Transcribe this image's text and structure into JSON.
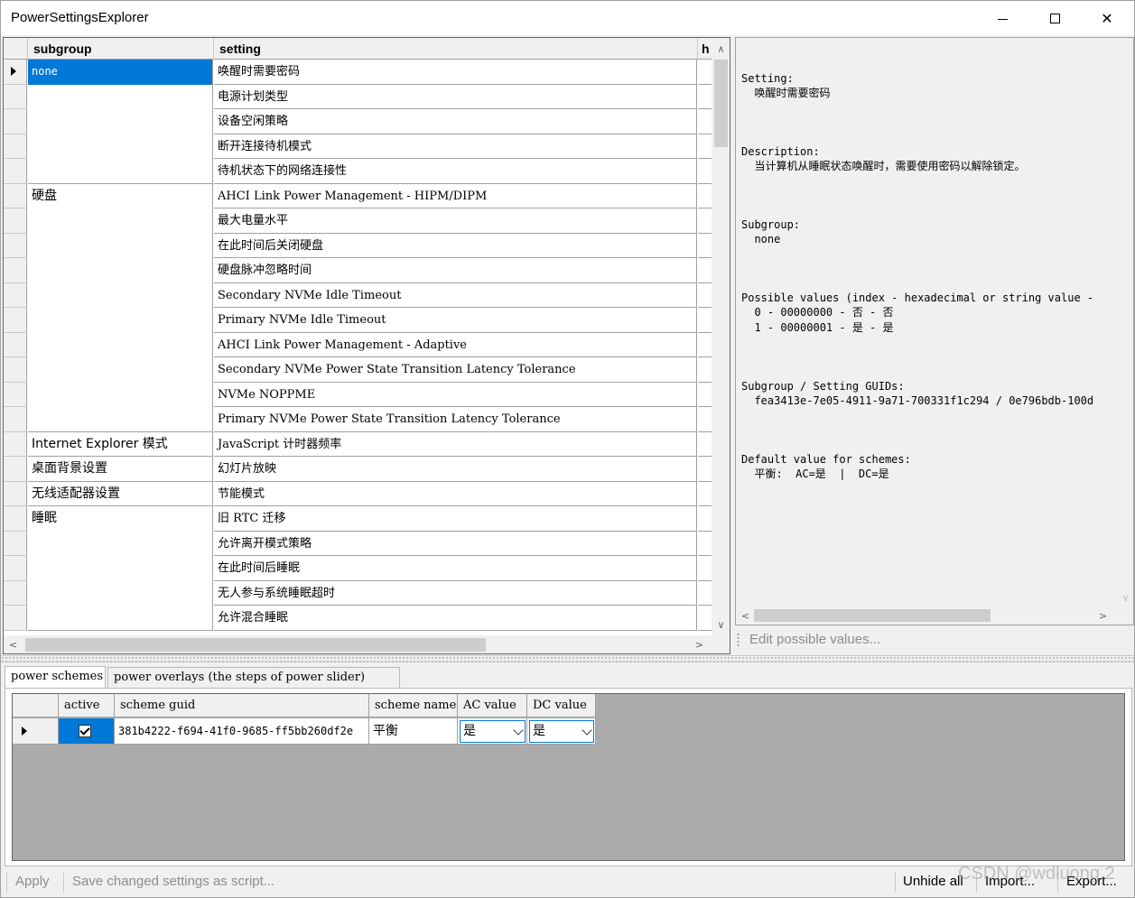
{
  "window": {
    "title": "PowerSettingsExplorer",
    "minimize_icon": "minimize-icon",
    "maximize_icon": "maximize-icon",
    "close_label": "✕"
  },
  "grid": {
    "columns": {
      "subgroup": "subgroup",
      "setting": "setting",
      "h": "h"
    },
    "rows": [
      {
        "subgroup": "none",
        "setting": "唤醒时需要密码",
        "selected": true
      },
      {
        "subgroup": "",
        "setting": "电源计划类型"
      },
      {
        "subgroup": "",
        "setting": "设备空闲策略"
      },
      {
        "subgroup": "",
        "setting": "断开连接待机模式"
      },
      {
        "subgroup": "",
        "setting": "待机状态下的网络连接性"
      },
      {
        "subgroup": "硬盘",
        "setting": "AHCI Link Power Management - HIPM/DIPM"
      },
      {
        "subgroup": "",
        "setting": "最大电量水平"
      },
      {
        "subgroup": "",
        "setting": "在此时间后关闭硬盘"
      },
      {
        "subgroup": "",
        "setting": "硬盘脉冲忽略时间"
      },
      {
        "subgroup": "",
        "setting": "Secondary NVMe Idle Timeout"
      },
      {
        "subgroup": "",
        "setting": "Primary NVMe Idle Timeout"
      },
      {
        "subgroup": "",
        "setting": "AHCI Link Power Management - Adaptive"
      },
      {
        "subgroup": "",
        "setting": "Secondary NVMe Power State Transition Latency Tolerance"
      },
      {
        "subgroup": "",
        "setting": "NVMe NOPPME"
      },
      {
        "subgroup": "",
        "setting": "Primary NVMe Power State Transition Latency Tolerance"
      },
      {
        "subgroup": "Internet Explorer 模式",
        "setting": "JavaScript 计时器频率"
      },
      {
        "subgroup": "桌面背景设置",
        "setting": "幻灯片放映"
      },
      {
        "subgroup": "无线适配器设置",
        "setting": "节能模式"
      },
      {
        "subgroup": "睡眠",
        "setting": "旧 RTC 迁移"
      },
      {
        "subgroup": "",
        "setting": "允许离开模式策略"
      },
      {
        "subgroup": "",
        "setting": "在此时间后睡眠"
      },
      {
        "subgroup": "",
        "setting": "无人参与系统睡眠超时"
      },
      {
        "subgroup": "",
        "setting": "允许混合睡眠"
      }
    ],
    "scroll_up": "∧",
    "scroll_down": "∨",
    "scroll_left": "<",
    "scroll_right": ">"
  },
  "info": {
    "setting_label": "Setting:",
    "setting_value": "  唤醒时需要密码",
    "description_label": "Description:",
    "description_value": "  当计算机从睡眠状态唤醒时，需要使用密码以解除锁定。",
    "subgroup_label": "Subgroup:",
    "subgroup_value": "  none",
    "possible_label": "Possible values (index - hexadecimal or string value -",
    "possible_0": "  0 - 00000000 - 否 - 否",
    "possible_1": "  1 - 00000001 - 是 - 是",
    "guids_label": "Subgroup / Setting GUIDs:",
    "guids_value": "  fea3413e-7e05-4911-9a71-700331f1c294 / 0e796bdb-100d",
    "default_label": "Default value for schemes:",
    "default_value": "  平衡:  AC=是  |  DC=是",
    "edit_values": "Edit possible values..."
  },
  "tabs": [
    {
      "label": "power schemes",
      "active": true
    },
    {
      "label": "power overlays (the steps of power slider)",
      "active": false
    }
  ],
  "schemes": {
    "columns": {
      "active": "active",
      "guid": "scheme guid",
      "name": "scheme name",
      "ac": "AC value",
      "dc": "DC value"
    },
    "rows": [
      {
        "active": true,
        "guid": "381b4222-f694-41f0-9685-ff5bb260df2e",
        "name": "平衡",
        "ac": "是",
        "dc": "是"
      }
    ]
  },
  "statusbar": {
    "apply": "Apply",
    "save_script": "Save changed settings as script...",
    "unhide_all": "Unhide all",
    "import": "Import...",
    "export": "Export..."
  },
  "watermark": "CSDN @wdluong.2",
  "colors": {
    "selection": "#0078d7",
    "grid_background": "#ababab",
    "disabled_text": "#8c8c8c"
  }
}
